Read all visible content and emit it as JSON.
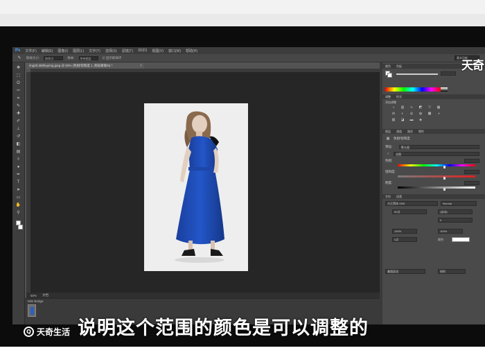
{
  "app": {
    "logo": "Ps",
    "menu": [
      "文件(F)",
      "编辑(E)",
      "图像(I)",
      "图层(L)",
      "文字(Y)",
      "选择(S)",
      "滤镜(T)",
      "3D(D)",
      "视图(V)",
      "窗口(W)",
      "帮助(H)"
    ],
    "options": {
      "sample_size_label": "取样大小:",
      "sample_size_value": "取样点",
      "sample_label": "样本:",
      "sample_value": "所有图层",
      "show_ring": "显示取样环",
      "workspace": "基本功能"
    }
  },
  "document": {
    "tab_label": "img20.360buyimg.jpeg @ 50% (色相/饱和度 1, 图层蒙版/8) *",
    "close": "×",
    "status_zoom": "50%",
    "status_doc": "文档",
    "mini_bridge_label": "Mini Bridge"
  },
  "panels": {
    "color_tabs": [
      "颜色",
      "色板"
    ],
    "adjust_tabs": [
      "调整",
      "样式"
    ],
    "adjust_title": "添加调整",
    "properties_tabs": [
      "图层",
      "通道",
      "路径",
      "属性"
    ],
    "properties_title": "色相/饱和度",
    "preset_label": "预设:",
    "preset_value": "默认值",
    "channel_value": "全图",
    "hue_label": "色相:",
    "saturation_label": "饱和度:",
    "lightness_label": "明度:",
    "character_tabs": [
      "字符",
      "段落"
    ],
    "font_family": "方正黑体 GBK",
    "font_style": "Normal",
    "font_size": "60点",
    "leading": "(自动)",
    "tracking": "0",
    "scale_v": "100%",
    "scale_h": "100%",
    "baseline": "0点",
    "color_label": "颜色:",
    "language": "美国英语",
    "aa": "锐利"
  },
  "toolbar_icons": [
    "move-icon",
    "marquee-icon",
    "lasso-icon",
    "quick-select-icon",
    "crop-icon",
    "eyedropper-icon",
    "healing-icon",
    "brush-icon",
    "stamp-icon",
    "history-brush-icon",
    "eraser-icon",
    "gradient-icon",
    "blur-icon",
    "dodge-icon",
    "pen-icon",
    "type-icon",
    "path-select-icon",
    "shape-icon",
    "hand-icon",
    "zoom-icon"
  ],
  "watermark": "天奇",
  "subtitle": "说明这个范围的颜色是可以调整的",
  "brand": {
    "icon": "Q",
    "name": "天奇生活"
  }
}
